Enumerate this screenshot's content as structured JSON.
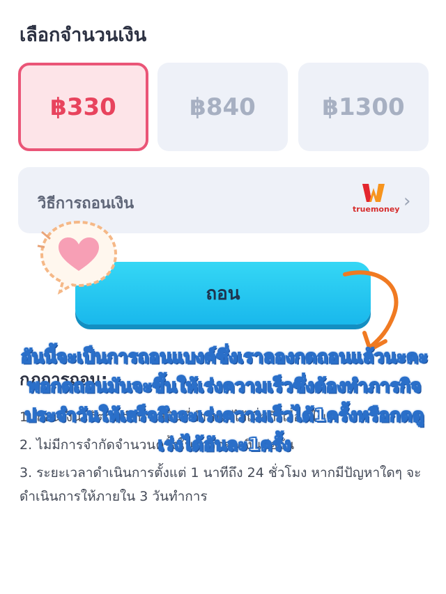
{
  "amount_section": {
    "title": "เลือกจำนวนเงิน",
    "options": [
      {
        "label": "฿330",
        "selected": true
      },
      {
        "label": "฿840",
        "selected": false
      },
      {
        "label": "฿1300",
        "selected": false
      }
    ]
  },
  "withdraw_method": {
    "label": "วิธีการถอนเงิน",
    "provider_text": "truemoney"
  },
  "withdraw_button": {
    "label": "ถอน"
  },
  "rules": {
    "title": "กฎการถอน:",
    "items": [
      "1. ถอนเงินได้ตามจำนวนเงินที่กำหนดไว้เมื่อถึงเงื่อนไข",
      "2. ไม่มีการจำกัดจำนวนครั้งในการถอนเงินต่อวัน",
      "3. ระยะเวลาดำเนินการตั้งแต่ 1 นาทีถึง 24 ชั่วโมง หากมีปัญหาใดๆ จะดำเนินการให้ภายใน 3 วันทำการ"
    ]
  },
  "overlay_caption": "อันนี้จะเป็นการถอนแบงค์ซึ่งเราลองกดถอนแล้วนะคะ พอกดถอนมันจะขึ้นให้เร่งความเร็วซึ่งต้องทำภารกิจประจำวันให้เสร็จถึงจะเร่งความเร็วได้1ครั้งหรือกดดูเร่งได้อันละ1ครั้ง",
  "colors": {
    "selected_border": "#ea5577",
    "selected_text": "#e8435d",
    "button": "#1fc3f0",
    "card_bg": "#eef1f8"
  }
}
